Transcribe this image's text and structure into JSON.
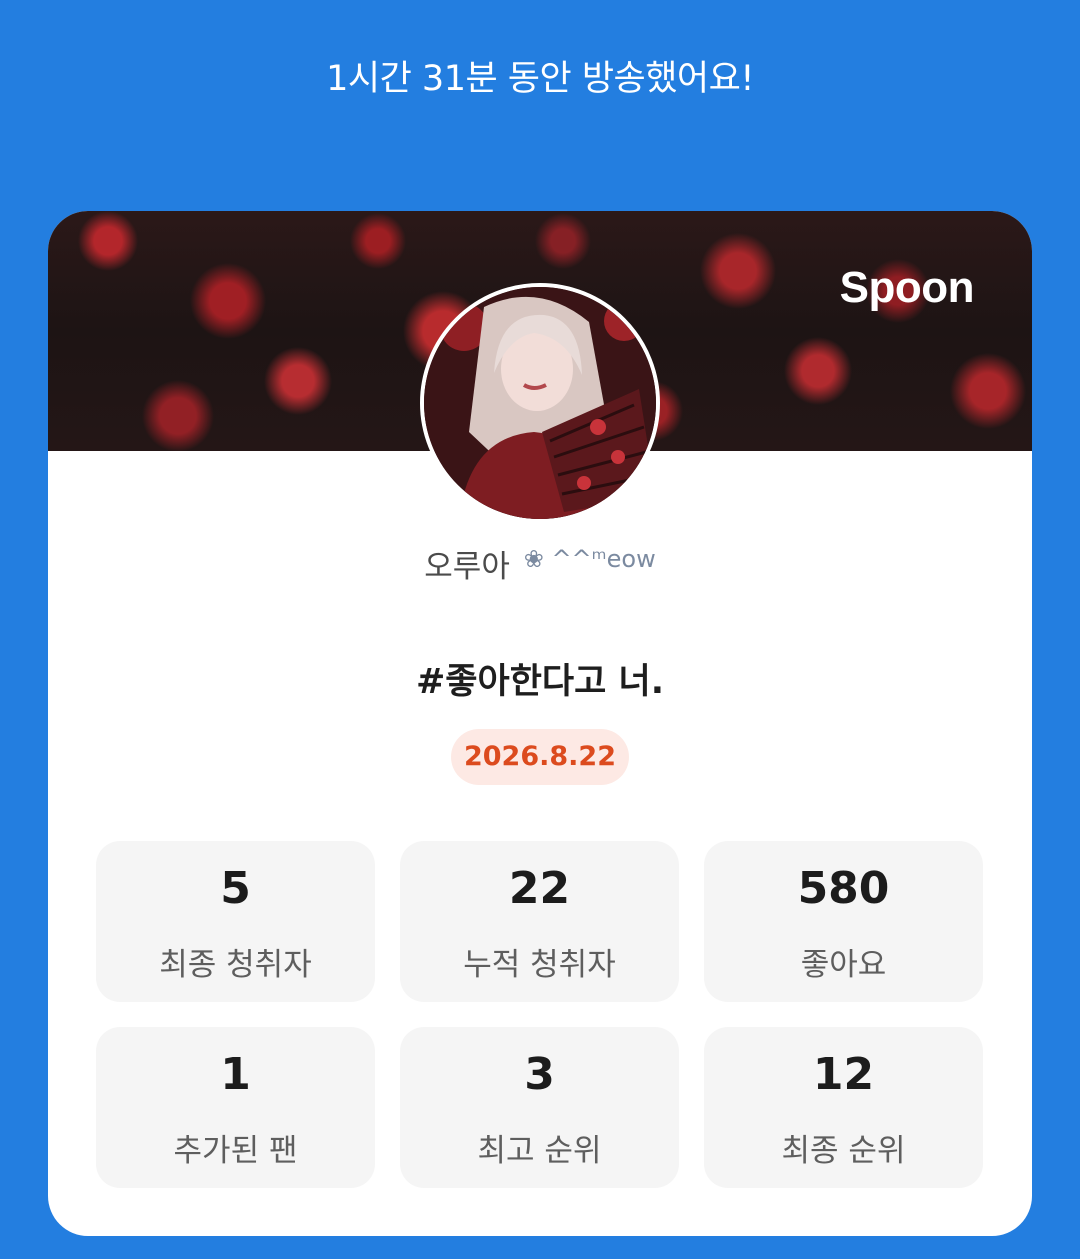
{
  "header": {
    "top_fragment": "' ' '",
    "duration_text": "1시간 31분 동안 방송했어요!"
  },
  "card": {
    "brand": "Spoon",
    "host_name": "오루아",
    "host_decoration": "❀ ^^ᵐeow",
    "broadcast_title": "#좋아한다고 너.",
    "date": "2026.8.22"
  },
  "stats": [
    {
      "value": "5",
      "label": "최종 청취자"
    },
    {
      "value": "22",
      "label": "누적 청취자"
    },
    {
      "value": "580",
      "label": "좋아요"
    },
    {
      "value": "1",
      "label": "추가된 팬"
    },
    {
      "value": "3",
      "label": "최고 순위"
    },
    {
      "value": "12",
      "label": "최종 순위"
    }
  ],
  "colors": {
    "background": "#237ee0",
    "card": "#ffffff",
    "date_badge_bg": "#fde9e4",
    "date_badge_text": "#dc4b1e",
    "stat_tile": "#f5f5f5"
  },
  "icons": {
    "avatar": "profile-picture",
    "cover": "rose-cover-image"
  }
}
